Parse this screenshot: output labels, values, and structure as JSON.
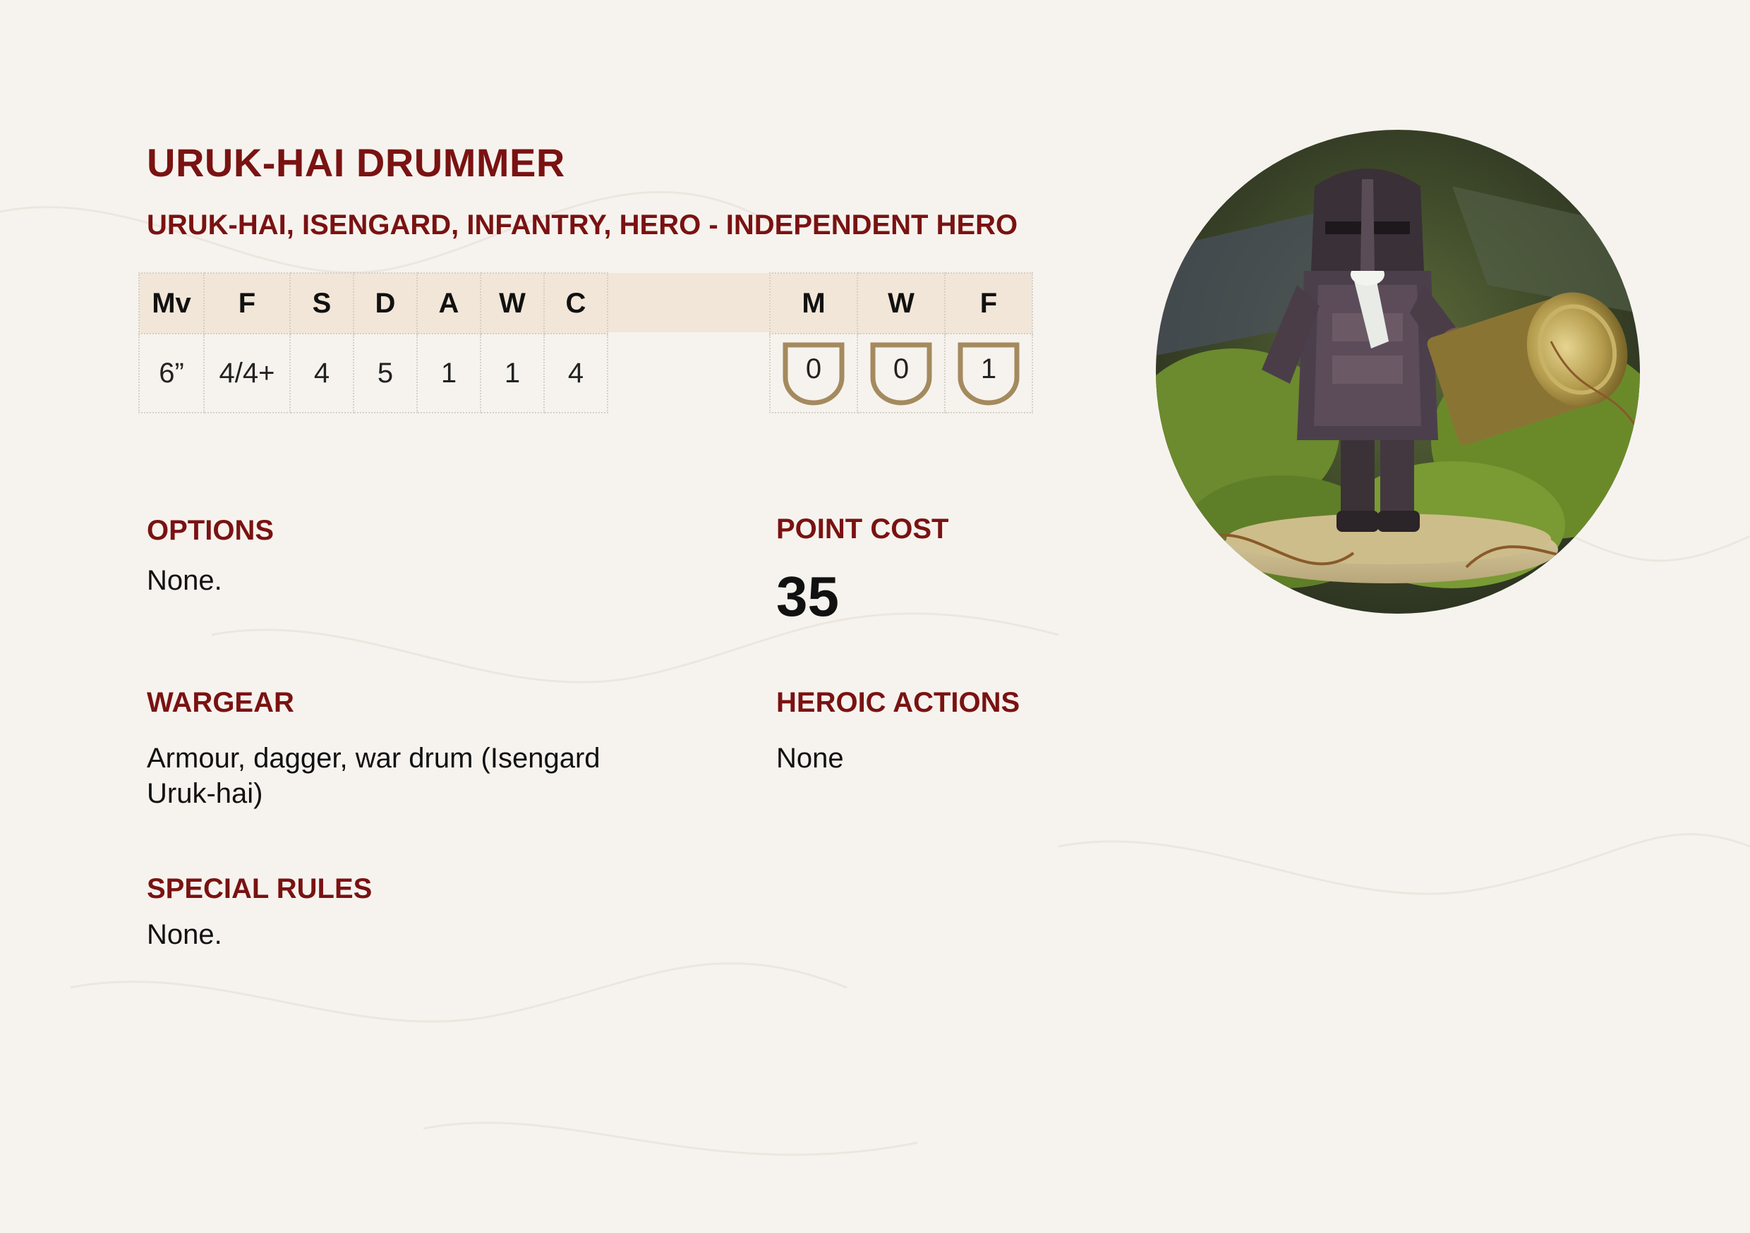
{
  "title": "URUK-HAI DRUMMER",
  "keywords": "URUK-HAI, ISENGARD, INFANTRY, HERO - INDEPENDENT HERO",
  "stats": {
    "headers": [
      "Mv",
      "F",
      "S",
      "D",
      "A",
      "W",
      "C"
    ],
    "values": [
      "6”",
      "4/4+",
      "4",
      "5",
      "1",
      "1",
      "4"
    ]
  },
  "hero_stats": {
    "headers": [
      "M",
      "W",
      "F"
    ],
    "values": [
      "0",
      "0",
      "1"
    ]
  },
  "options": {
    "heading": "OPTIONS",
    "text": "None."
  },
  "point_cost": {
    "heading": "POINT COST",
    "value": "35"
  },
  "wargear": {
    "heading": "WARGEAR",
    "line1": "Armour, dagger, war drum (Isengard",
    "line2": "Uruk-hai)"
  },
  "heroic_actions": {
    "heading": "HEROIC ACTIONS",
    "text": "None"
  },
  "special_rules": {
    "heading": "SPECIAL RULES",
    "text": "None."
  },
  "colors": {
    "accent": "#7a1212",
    "header_band": "#f2e6d8",
    "shield": "#a48a5e",
    "background": "#f6f3ee"
  },
  "portrait": {
    "icon": "uruk-hai-drummer-miniature-photo"
  }
}
